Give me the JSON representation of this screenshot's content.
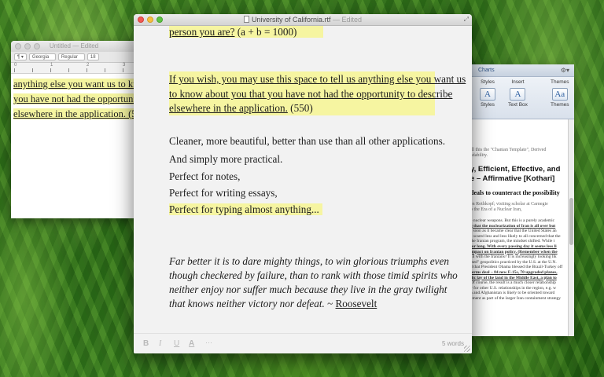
{
  "left_window": {
    "title": "Untitled",
    "title_suffix": "— Edited",
    "font_family": "Georgia",
    "font_style": "Regular",
    "font_size": "18",
    "ruler_numbers": [
      "0",
      "1",
      "2",
      "3"
    ],
    "lines": [
      "anything else you want us to kno",
      "you have not had the opportunit",
      "elsewhere in the application. (55"
    ]
  },
  "right_window": {
    "tab_label": "Charts",
    "groups": [
      "Styles",
      "Insert",
      "Themes"
    ],
    "buttons": [
      "Styles",
      "Text Box",
      "Themes"
    ],
    "lines_small": [
      "ill this the \"Chanian Template\", Derived",
      "adability."
    ],
    "heading_lines": [
      "y, Efficient, Effective, and",
      "e – Affirmative [Kothari]"
    ],
    "subheading": "deals to counteract the possibility",
    "author_lines": [
      "en Rothkopf; visiting scholar at Carnegie",
      "o the Era of a Nuclear Iran,"
    ],
    "body_lines": [
      "e nuclear weapons. But this is a purely academic",
      "g that the nuclearization of Iran is all over but",
      "s soon as it became clear that the United States an",
      "e scared less and less likely to all concerned that the",
      "the Iranian program, the mindset shifted. While t",
      "for long. With every passing day it seems less li",
      "impact on Iranian policy. (Remember when the",
      "ail with the Iranians? It is increasingly looking lik",
      "ised\" geopolitics practiced by the U.S. at the U.N.",
      "d that President Obama blessed the Brazil-Turkey off",
      "terms deal – 84 new F-15s, 70 upgraded planes,",
      "dic lay of the land in the Middle East, a plan to",
      "Of course, the result is a much closer relationship",
      "y for other U.S. relationships in the region, e.g. w",
      "n and Afghanistan is likely to be oriented toward",
      "ement as part of the larger Iran containment strategy"
    ]
  },
  "main_window": {
    "title": "University of California.rtf",
    "edited": "— Edited",
    "top_line_highlight": "person you are?",
    "top_line_rest": " (a + b = 1000)",
    "prompt_lines": [
      "If you wish, you may use this space to tell us anything else you want us",
      "to know about you that you have not had the opportunity to describe",
      "elsewhere in the application."
    ],
    "prompt_count": " (550)",
    "body_lines": [
      "Cleaner, more beautiful, better than use than all other applications.",
      "And simply more practical.",
      "Perfect for notes,",
      "Perfect for writing essays,"
    ],
    "body_highlight_line": "Perfect for typing almost anything...",
    "quote_lines": [
      "Far better it is to dare mighty things, to win glorious triumphs even",
      "though checkered by failure, than to rank with those timid spirits who",
      "neither enjoy nor suffer much because they live in the gray twilight",
      "that knows neither victory nor defeat."
    ],
    "quote_attribution_prefix": " ~ ",
    "quote_author": "Roosevelt",
    "format_buttons": {
      "bold": "B",
      "italic": "I",
      "underline": "U",
      "font": "A",
      "more": "···"
    },
    "word_count": "5 words",
    "highlight_color": "#f6f5a1"
  }
}
